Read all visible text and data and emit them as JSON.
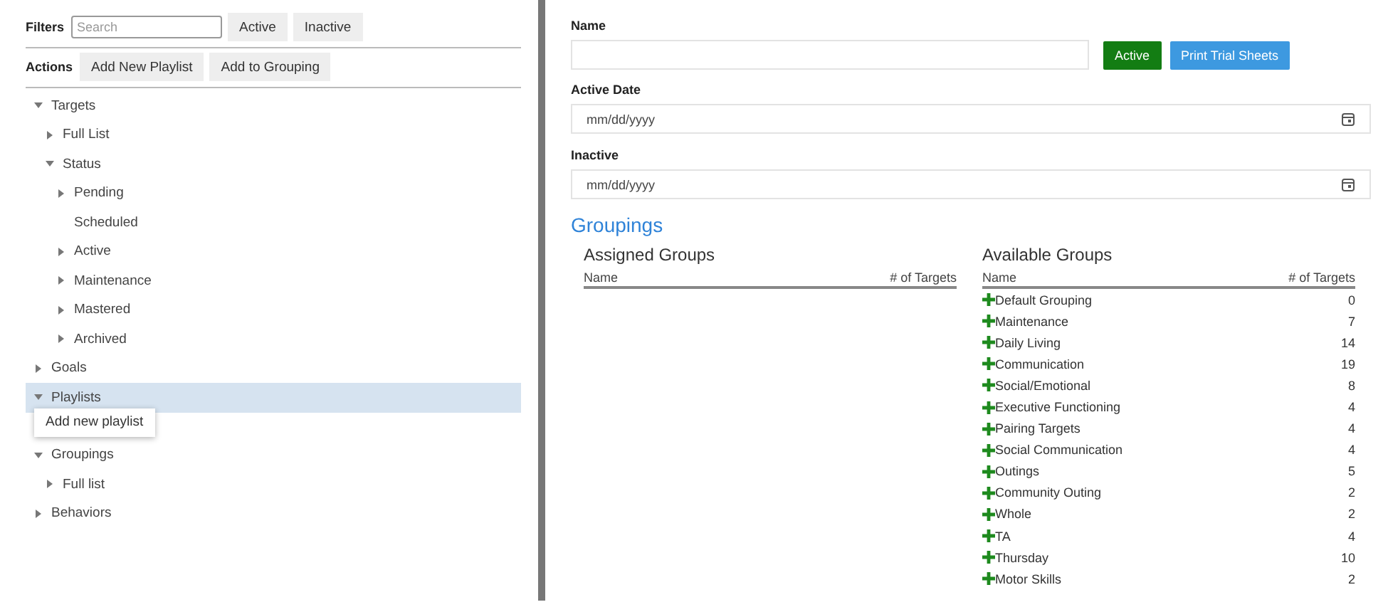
{
  "filters": {
    "label": "Filters",
    "search": {
      "placeholder": "Search"
    },
    "buttons": [
      "Active",
      "Inactive"
    ]
  },
  "actions": {
    "label": "Actions",
    "buttons": [
      "Add New Playlist",
      "Add to Grouping"
    ]
  },
  "tree": [
    {
      "label": "Targets",
      "kind": "branch",
      "expanded": true,
      "selected": false,
      "children": [
        {
          "label": "Full List",
          "kind": "branch",
          "expanded": false,
          "selected": false
        },
        {
          "label": "Status",
          "kind": "branch",
          "expanded": true,
          "selected": false,
          "children": [
            {
              "label": "Pending",
              "kind": "branch",
              "expanded": false,
              "selected": false
            },
            {
              "label": "Scheduled",
              "kind": "leaf",
              "selected": false
            },
            {
              "label": "Active",
              "kind": "branch",
              "expanded": false,
              "selected": false
            },
            {
              "label": "Maintenance",
              "kind": "branch",
              "expanded": false,
              "selected": false
            },
            {
              "label": "Mastered",
              "kind": "branch",
              "expanded": false,
              "selected": false
            },
            {
              "label": "Archived",
              "kind": "branch",
              "expanded": false,
              "selected": false
            }
          ]
        }
      ]
    },
    {
      "label": "Goals",
      "kind": "branch",
      "expanded": false,
      "selected": false
    },
    {
      "label": "Playlists",
      "kind": "branch",
      "expanded": true,
      "selected": true,
      "menu": [
        "Add new playlist"
      ]
    },
    {
      "label": "Groupings",
      "kind": "branch",
      "expanded": true,
      "selected": false,
      "children": [
        {
          "label": "Full list",
          "kind": "branch",
          "expanded": false,
          "selected": false
        }
      ]
    },
    {
      "label": "Behaviors",
      "kind": "branch",
      "expanded": false,
      "selected": false
    }
  ],
  "form": {
    "name_label": "Name",
    "active_button": "Active",
    "print_button": "Print Trial Sheets",
    "fields": [
      {
        "label": "Active Date",
        "placeholder": "mm/dd/yyyy"
      },
      {
        "label": "Inactive",
        "placeholder": "mm/dd/yyyy"
      }
    ]
  },
  "groupings": {
    "title": "Groupings",
    "assigned": {
      "title": "Assigned Groups",
      "columns": [
        "Name",
        "# of Targets"
      ]
    },
    "available": {
      "title": "Available Groups",
      "columns": [
        "Name",
        "# of Targets"
      ],
      "rows": [
        {
          "name": "Default Grouping",
          "count": "0"
        },
        {
          "name": "Maintenance",
          "count": "7"
        },
        {
          "name": "Daily Living",
          "count": "14"
        },
        {
          "name": "Communication",
          "count": "19"
        },
        {
          "name": "Social/Emotional",
          "count": "8"
        },
        {
          "name": "Executive Functioning",
          "count": "4"
        },
        {
          "name": "Pairing Targets",
          "count": "4"
        },
        {
          "name": "Social Communication",
          "count": "4"
        },
        {
          "name": "Outings",
          "count": "5"
        },
        {
          "name": "Community Outing",
          "count": "2"
        },
        {
          "name": "Whole",
          "count": "2"
        },
        {
          "name": "TA",
          "count": "4"
        },
        {
          "name": "Thursday",
          "count": "10"
        },
        {
          "name": "Motor Skills",
          "count": "2"
        }
      ]
    }
  }
}
